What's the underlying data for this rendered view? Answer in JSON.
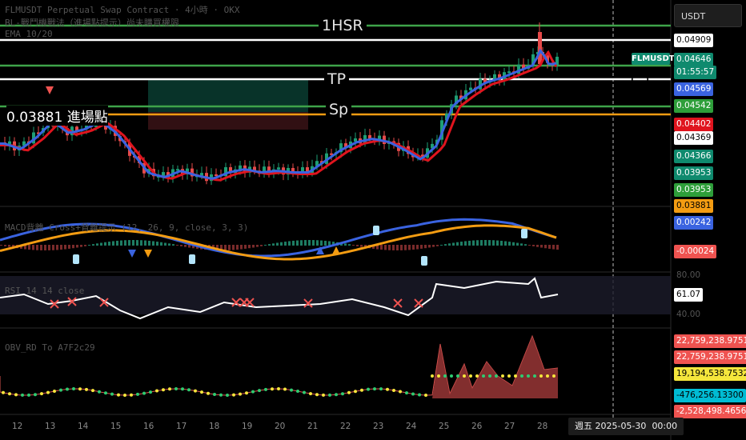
{
  "header": {
    "line1": "FLMUSDT Perpetual Swap Contract · 4小時 · OKX",
    "line2": "BL-戰鬥機戰法（進場點提示）尚未購買權限",
    "line3": "EMA 10/20"
  },
  "currency_label": "USDT",
  "symbol_tag": "FLMUSDT.P",
  "emoji": "😊",
  "levels": {
    "hsr": "1HSR",
    "tp": "TP",
    "sp": "Sp"
  },
  "entry_label": "0.03881 進場點",
  "pane2_title": "MACD背離 Cross+背離提示 (12, 26, 9, close, 3, 3)",
  "pane3_title": "RSI 14 14 close",
  "pane4_title": "OBV_RD To A7F2c29",
  "price_tags": [
    {
      "text": "0.04909",
      "bg": "#ffffff",
      "fg": "#000000"
    },
    {
      "text": "0.04646",
      "bg": "#0f8a6e",
      "fg": "#ffffff"
    },
    {
      "text": "01:55:57",
      "bg": "#0f8a6e",
      "fg": "#ffffff"
    },
    {
      "text": "0.04569",
      "bg": "#3a63e0",
      "fg": "#ffffff"
    },
    {
      "text": "0.04542",
      "bg": "#2e9e3a",
      "fg": "#ffffff"
    },
    {
      "text": "0.04402",
      "bg": "#e0141e",
      "fg": "#ffffff"
    },
    {
      "text": "0.04369",
      "bg": "#ffffff",
      "fg": "#000000"
    },
    {
      "text": "0.04366",
      "bg": "#0f8a6e",
      "fg": "#ffffff"
    },
    {
      "text": "0.03953",
      "bg": "#0f8a6e",
      "fg": "#ffffff"
    },
    {
      "text": "0.03953",
      "bg": "#2e9e3a",
      "fg": "#ffffff"
    },
    {
      "text": "0.03881",
      "bg": "#f39c12",
      "fg": "#000000"
    },
    {
      "text": "0.00242",
      "bg": "#3a63e0",
      "fg": "#ffffff"
    },
    {
      "text": "-0.00024",
      "bg": "#ef5350",
      "fg": "#ffffff"
    },
    {
      "text": "80.00",
      "bg": "#000000",
      "fg": "#555555"
    },
    {
      "text": "61.07",
      "bg": "#ffffff",
      "fg": "#000000"
    },
    {
      "text": "40.00",
      "bg": "#000000",
      "fg": "#555555"
    },
    {
      "text": "22,759,238.97511",
      "bg": "#ef5350",
      "fg": "#ffffff"
    },
    {
      "text": "22,759,238.97511",
      "bg": "#ef5350",
      "fg": "#ffffff"
    },
    {
      "text": "19,194,538.75327",
      "bg": "#f5e63c",
      "fg": "#000000"
    },
    {
      "text": "-476,256.13300",
      "bg": "#00bcd4",
      "fg": "#000000"
    },
    {
      "text": "-2,528,498.46569",
      "bg": "#ef5350",
      "fg": "#ffffff"
    }
  ],
  "x_axis_labels": [
    "12",
    "13",
    "14",
    "15",
    "16",
    "17",
    "18",
    "19",
    "20",
    "21",
    "22",
    "23",
    "24",
    "25",
    "26",
    "27",
    "28"
  ],
  "cursor_date": "週五 2025-05-30",
  "cursor_time": "00:00",
  "colors": {
    "up": "#1e9e74",
    "down": "#e64a4a",
    "ema_fast": "#3a63e0",
    "ema_slow": "#e0141e",
    "entry": "#f39c12",
    "level_green": "#3ea34a"
  }
}
